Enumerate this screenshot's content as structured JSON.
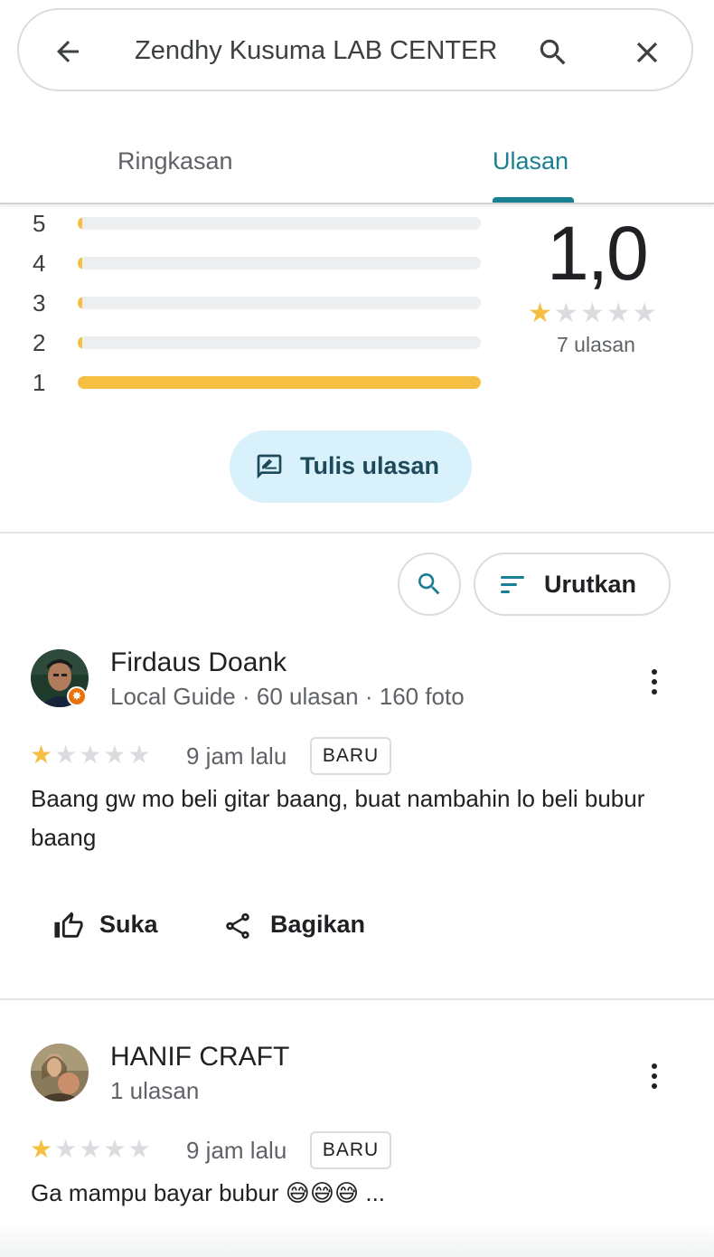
{
  "search": {
    "query": "Zendhy Kusuma LAB CENTER",
    "back_icon": "arrow-left-icon",
    "search_icon": "search-icon",
    "close_icon": "close-icon"
  },
  "tabs": [
    {
      "label": "Ringkasan",
      "active": false
    },
    {
      "label": "Ulasan",
      "active": true
    }
  ],
  "histogram": [
    {
      "star": "5",
      "fraction": 0.01
    },
    {
      "star": "4",
      "fraction": 0.01
    },
    {
      "star": "3",
      "fraction": 0.01
    },
    {
      "star": "2",
      "fraction": 0.01
    },
    {
      "star": "1",
      "fraction": 1.0
    }
  ],
  "summary": {
    "rating": "1,0",
    "stars_filled": 1,
    "review_count": "7 ulasan"
  },
  "write_review": {
    "label": "Tulis ulasan",
    "icon": "rate-review-icon"
  },
  "filters": {
    "search_icon": "search-icon",
    "sort_label": "Urutkan",
    "sort_icon": "sort-icon"
  },
  "reviews": [
    {
      "name": "Firdaus Doank",
      "meta": "Local Guide · 60 ulasan · 160 foto",
      "local_guide": true,
      "stars": 1,
      "time": "9 jam lalu",
      "badge": "BARU",
      "text": "Baang gw mo beli gitar baang, buat nambahin lo beli bubur baang"
    },
    {
      "name": "HANIF CRAFT",
      "meta": "1 ulasan",
      "local_guide": false,
      "stars": 1,
      "time": "9 jam lalu",
      "badge": "BARU",
      "text": "Ga mampu bayar bubur 😅😅😅 ..."
    }
  ],
  "actions": {
    "like": "Suka",
    "share": "Bagikan"
  },
  "colors": {
    "accent": "#1a7f91",
    "star": "#f4bf42",
    "star_empty": "#dadce0",
    "write_button_bg": "#d8f1fb"
  }
}
